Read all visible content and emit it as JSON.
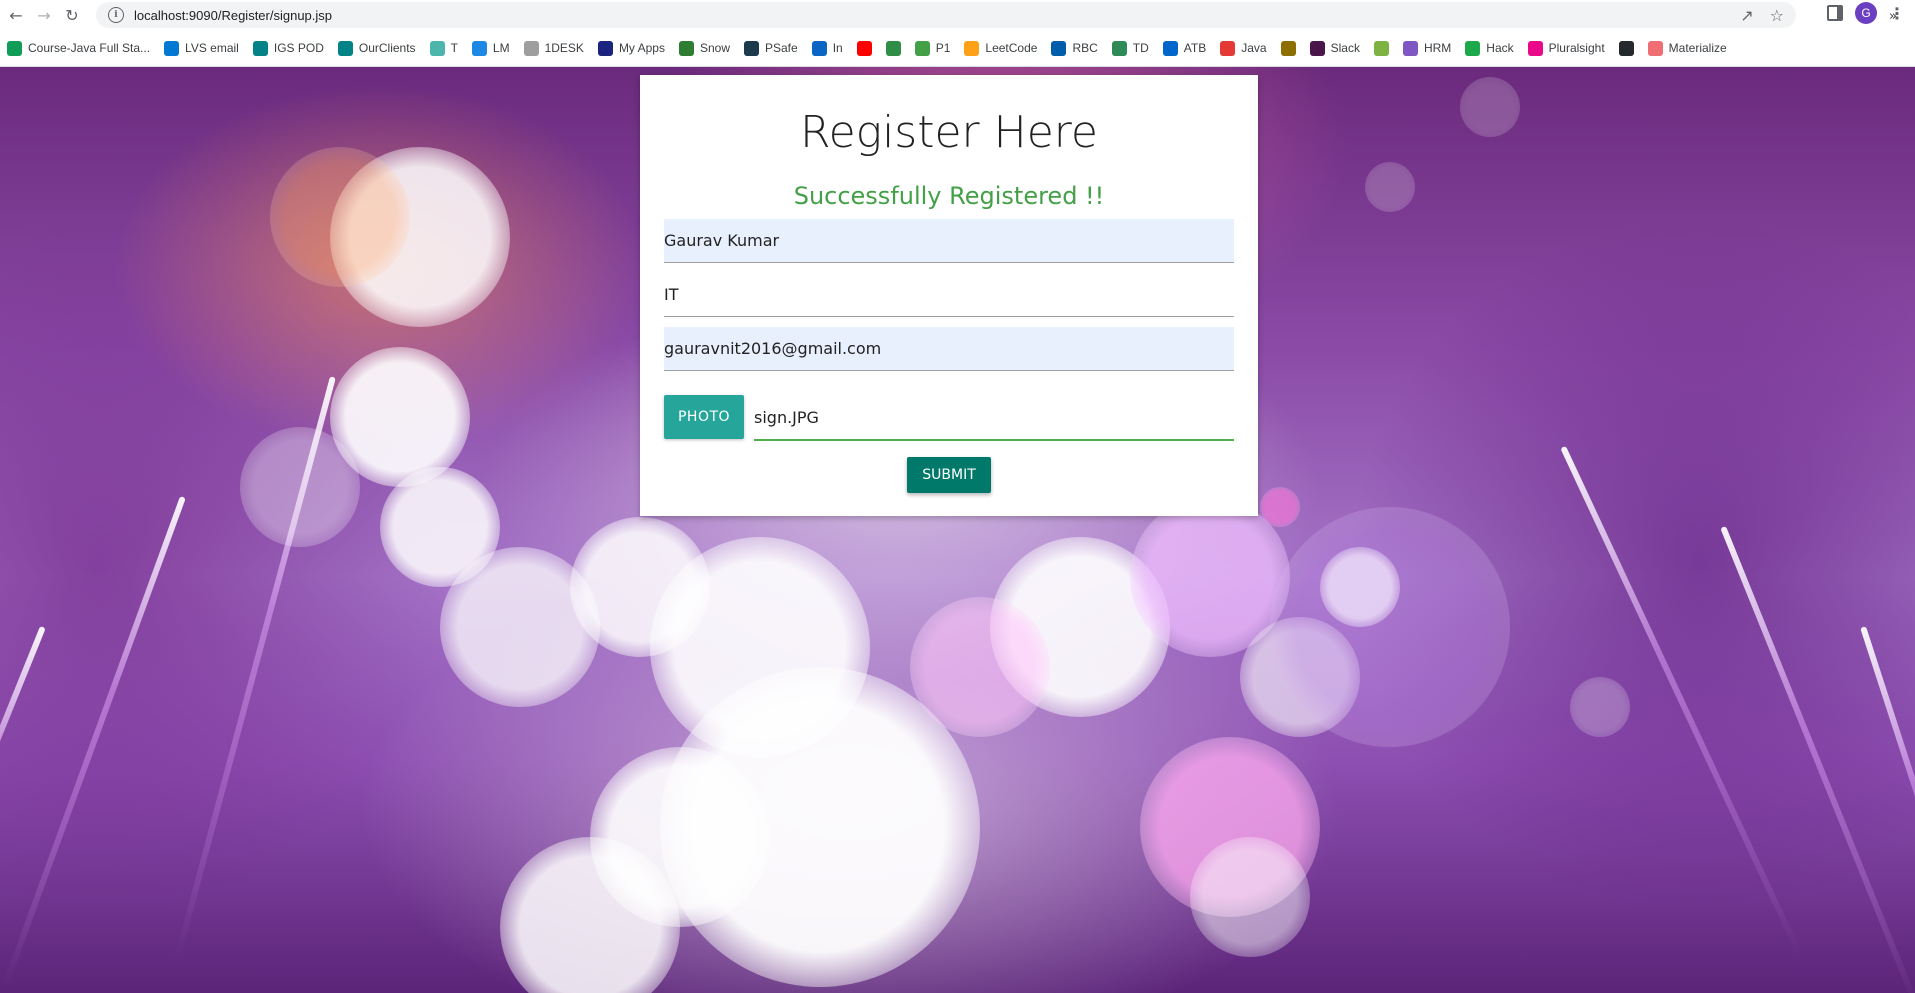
{
  "browser": {
    "url_host": "localhost:9090/Register/signup.jsp",
    "avatar_letter": "G",
    "bookmarks": [
      {
        "label": "Course-Java Full Sta...",
        "icon": "sheets-icon",
        "color": "#0f9d58"
      },
      {
        "label": "LVS email",
        "icon": "outlook-icon",
        "color": "#0078d4"
      },
      {
        "label": "IGS POD",
        "icon": "sharepoint-icon",
        "color": "#038387"
      },
      {
        "label": "OurClients",
        "icon": "sharepoint-icon",
        "color": "#038387"
      },
      {
        "label": "T",
        "icon": "globe-icon",
        "color": "#4db6ac"
      },
      {
        "label": "LM",
        "icon": "lm-icon",
        "color": "#1e88e5"
      },
      {
        "label": "1DESK",
        "icon": "chart-icon",
        "color": "#9e9e9e"
      },
      {
        "label": "My Apps",
        "icon": "okta-icon",
        "color": "#1a237e"
      },
      {
        "label": "Snow",
        "icon": "servicenow-icon",
        "color": "#2e7d32"
      },
      {
        "label": "PSafe",
        "icon": "psafe-icon",
        "color": "#1b3a4b"
      },
      {
        "label": "In",
        "icon": "linkedin-icon",
        "color": "#0a66c2"
      },
      {
        "label": "",
        "icon": "youtube-icon",
        "color": "#ff0000"
      },
      {
        "label": "",
        "icon": "geeksforgeeks-icon",
        "color": "#2f8d46"
      },
      {
        "label": "P1",
        "icon": "p1-icon",
        "color": "#43a047"
      },
      {
        "label": "LeetCode",
        "icon": "leetcode-icon",
        "color": "#ffa116"
      },
      {
        "label": "RBC",
        "icon": "rbc-icon",
        "color": "#005daa"
      },
      {
        "label": "TD",
        "icon": "td-icon",
        "color": "#2e8b57"
      },
      {
        "label": "ATB",
        "icon": "atb-icon",
        "color": "#0066cc"
      },
      {
        "label": "Java",
        "icon": "java-icon",
        "color": "#e53935"
      },
      {
        "label": "",
        "icon": "shield-icon",
        "color": "#8d6e00"
      },
      {
        "label": "Slack",
        "icon": "slack-icon",
        "color": "#4a154b"
      },
      {
        "label": "",
        "icon": "globe-icon",
        "color": "#7cb342"
      },
      {
        "label": "HRM",
        "icon": "hrm-icon",
        "color": "#7e57c2"
      },
      {
        "label": "Hack",
        "icon": "hackerrank-icon",
        "color": "#1ba94c"
      },
      {
        "label": "Pluralsight",
        "icon": "pluralsight-icon",
        "color": "#e80a89"
      },
      {
        "label": "",
        "icon": "github-icon",
        "color": "#24292e"
      },
      {
        "label": "Materialize",
        "icon": "materialize-icon",
        "color": "#ee6e73"
      }
    ],
    "more_label": "»"
  },
  "form": {
    "title": "Register Here",
    "success_message": "Successfully Registered !!",
    "name_value": "Gaurav Kumar",
    "department_value": "IT",
    "email_value": "gauravnit2016@gmail.com",
    "photo_button_label": "PHOTO",
    "photo_file_value": "sign.JPG",
    "submit_label": "SUBMIT"
  },
  "colors": {
    "success": "#43a047",
    "photo_button": "#26a69a",
    "submit_button": "#00796b",
    "autofill_bg": "#e8f0fe"
  }
}
